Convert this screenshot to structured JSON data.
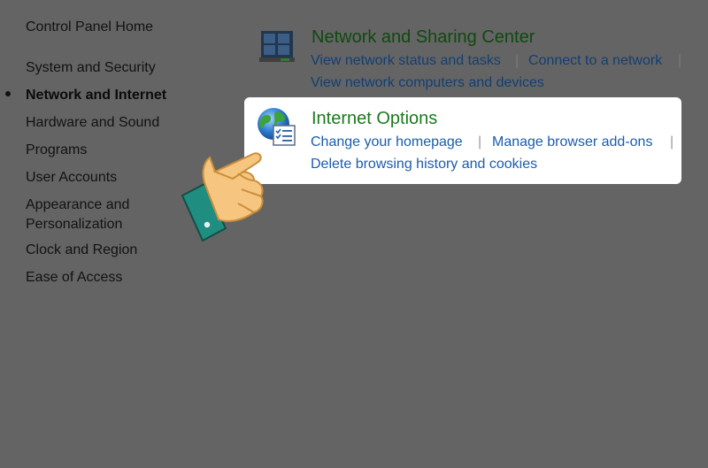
{
  "sidebar": {
    "items": [
      {
        "label": "Control Panel Home"
      },
      {
        "label": "System and Security"
      },
      {
        "label": "Network and Internet"
      },
      {
        "label": "Hardware and Sound"
      },
      {
        "label": "Programs"
      },
      {
        "label": "User Accounts"
      },
      {
        "label": "Appearance and"
      },
      {
        "label": "Personalization"
      },
      {
        "label": "Clock and Region"
      },
      {
        "label": "Ease of Access"
      }
    ]
  },
  "categories": [
    {
      "title": "Network and Sharing Center",
      "links": [
        "View network status and tasks",
        "Connect to a network",
        "View network computers and devices"
      ],
      "icon": "network-icon"
    },
    {
      "title": "Internet Options",
      "links": [
        "Change your homepage",
        "Manage browser add-ons",
        "Delete browsing history and cookies"
      ],
      "icon": "internet-options-globe-icon"
    }
  ],
  "separator": "|",
  "colors": {
    "overlay_background": "#646464",
    "highlight_background": "#ffffff",
    "title_green": "#1b7a1d",
    "link_blue": "#1a5cb0",
    "hand_skin": "#f6c57f",
    "cuff_teal": "#1f8e80"
  },
  "pointer": {
    "icon": "pointing-hand-icon"
  }
}
